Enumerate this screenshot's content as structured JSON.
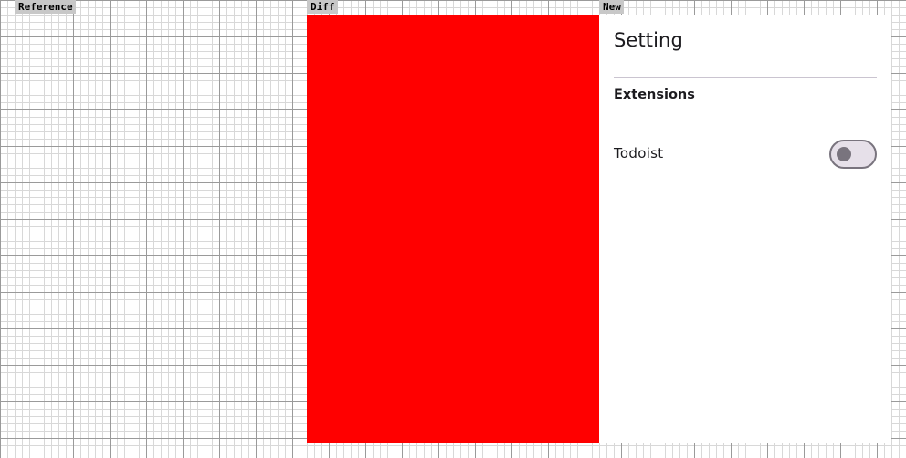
{
  "labels": {
    "reference": "Reference",
    "diff": "Diff",
    "new": "New"
  },
  "colors": {
    "diff_fill": "#ff0000",
    "panel_background": "#ffffff",
    "switch_outline": "#79747e",
    "switch_track": "#e6e0e9",
    "divider": "#cac4d0"
  },
  "settings": {
    "title": "Setting",
    "section_header": "Extensions",
    "extensions": [
      {
        "label": "Todoist",
        "enabled": false
      }
    ]
  }
}
